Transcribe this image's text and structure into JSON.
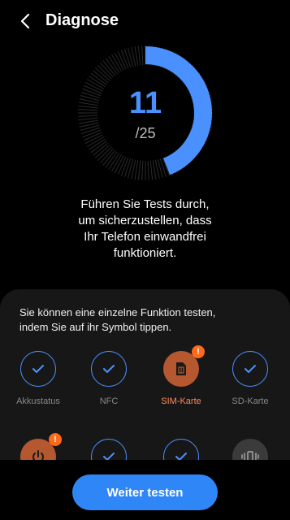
{
  "header": {
    "title": "Diagnose"
  },
  "progress": {
    "completed": "11",
    "total_label": "/25",
    "completed_count": 11,
    "total_count": 25
  },
  "colors": {
    "accent": "#4a91ff",
    "warning": "#ff6a1a",
    "warning_bg": "#b5572f"
  },
  "description": {
    "lines": [
      "Führen Sie Tests durch,",
      "um sicherzustellen, dass",
      "Ihr Telefon einwandfrei",
      "funktioniert."
    ]
  },
  "panel": {
    "hint_lines": [
      "Sie können eine einzelne Funktion testen,",
      "indem Sie auf ihr Symbol tippen."
    ],
    "tiles": [
      {
        "label": "Akkustatus",
        "status": "ok",
        "icon": "check-icon"
      },
      {
        "label": "NFC",
        "status": "ok",
        "icon": "check-icon"
      },
      {
        "label": "SIM-Karte",
        "status": "warning",
        "icon": "sim-card-icon",
        "badge": "!"
      },
      {
        "label": "SD-Karte",
        "status": "ok",
        "icon": "check-icon"
      },
      {
        "label": "",
        "status": "warning",
        "icon": "power-icon",
        "badge": "!"
      },
      {
        "label": "",
        "status": "ok",
        "icon": "check-icon"
      },
      {
        "label": "",
        "status": "ok",
        "icon": "check-icon"
      },
      {
        "label": "",
        "status": "untested",
        "icon": "vibration-icon"
      }
    ]
  },
  "actions": {
    "continue_label": "Weiter testen"
  }
}
